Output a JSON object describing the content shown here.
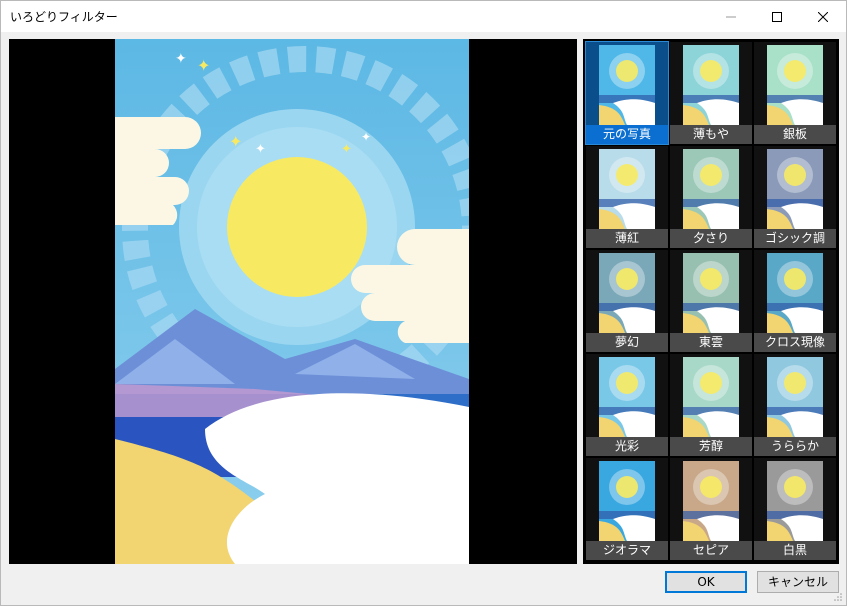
{
  "window": {
    "title": "いろどりフィルター"
  },
  "filters": [
    {
      "label": "元の写真",
      "selected": true,
      "tint": "#4fb8e8"
    },
    {
      "label": "薄もや",
      "selected": false,
      "tint": "#8cd4d8"
    },
    {
      "label": "銀板",
      "selected": false,
      "tint": "#a8e0c8"
    },
    {
      "label": "薄紅",
      "selected": false,
      "tint": "#b8dcea"
    },
    {
      "label": "夕さり",
      "selected": false,
      "tint": "#9cc8b8"
    },
    {
      "label": "ゴシック調",
      "selected": false,
      "tint": "#8a9ab8"
    },
    {
      "label": "夢幻",
      "selected": false,
      "tint": "#7aa8b8"
    },
    {
      "label": "東雲",
      "selected": false,
      "tint": "#98c0b0"
    },
    {
      "label": "クロス現像",
      "selected": false,
      "tint": "#5aa8c8"
    },
    {
      "label": "光彩",
      "selected": false,
      "tint": "#7ac8e8"
    },
    {
      "label": "芳醇",
      "selected": false,
      "tint": "#a8d8c8"
    },
    {
      "label": "うららか",
      "selected": false,
      "tint": "#90c8e0"
    },
    {
      "label": "ジオラマ",
      "selected": false,
      "tint": "#3aa8e0"
    },
    {
      "label": "セピア",
      "selected": false,
      "tint": "#c8a888"
    },
    {
      "label": "白黒",
      "selected": false,
      "tint": "#9a9a9a"
    }
  ],
  "buttons": {
    "ok": "OK",
    "cancel": "キャンセル"
  }
}
